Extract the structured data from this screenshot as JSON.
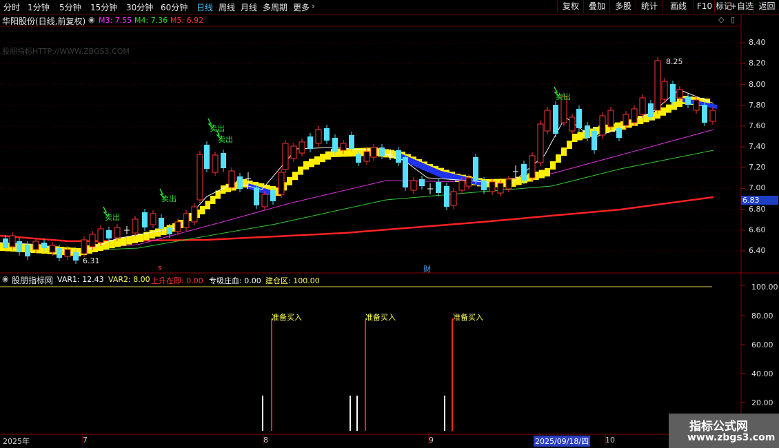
{
  "toolbar": {
    "periods": [
      "分时",
      "1分钟",
      "5分钟",
      "15分钟",
      "30分钟",
      "60分钟",
      "日线",
      "周线",
      "月线",
      "多周期",
      "更多"
    ],
    "active_period": "日线",
    "buttons": [
      "复权",
      "叠加",
      "多股",
      "统计",
      "画线",
      "F10",
      "标记",
      "+自选",
      "返回"
    ]
  },
  "main_chart": {
    "stock_title": "华阳股份(日线,前复权)",
    "ma_legend": [
      {
        "label": "M3: 7.55",
        "color": "#ff33ff"
      },
      {
        "label": "M4: 7.36",
        "color": "#33dd33"
      },
      {
        "label": "M5: 6.92",
        "color": "#ff3333"
      }
    ],
    "watermark": "股朋指标HTTP://WWW.ZBGS3.COM",
    "y_axis_labels": [
      "8.40",
      "8.20",
      "8.00",
      "7.80",
      "7.60",
      "7.40",
      "7.20",
      "7.00",
      "6.80",
      "6.60",
      "6.40"
    ],
    "current_price_tag": "6.83",
    "annotations": {
      "high": "8.25",
      "low": "6.31",
      "sell": "卖出",
      "cai": "财"
    }
  },
  "indicator": {
    "title": "股朋指标网",
    "values": [
      {
        "label": "VAR1: 12.43",
        "color": "#ffffff"
      },
      {
        "label": "VAR2: 8.00",
        "color": "#ffff55"
      },
      {
        "label": "上升在即: 0.00",
        "color": "#ff3333"
      },
      {
        "label": "专吸庄血: 0.00",
        "color": "#ffffff"
      },
      {
        "label": "建仓区: 100.00",
        "color": "#ffff55"
      }
    ],
    "y_axis_labels": [
      "100.00",
      "80.00",
      "60.00",
      "40.00",
      "20.00"
    ],
    "buy_label": "准备买入"
  },
  "date_axis": {
    "labels": [
      "2025年",
      "7",
      "8",
      "9",
      "2025/09/18/四",
      "10"
    ]
  },
  "site_watermark": {
    "line1": "指标公式网",
    "line2": "www.zbgs3.com"
  },
  "colors": {
    "background": "#000000",
    "grid_red": "#8a0000",
    "active_tab": "#48c8ff"
  }
}
